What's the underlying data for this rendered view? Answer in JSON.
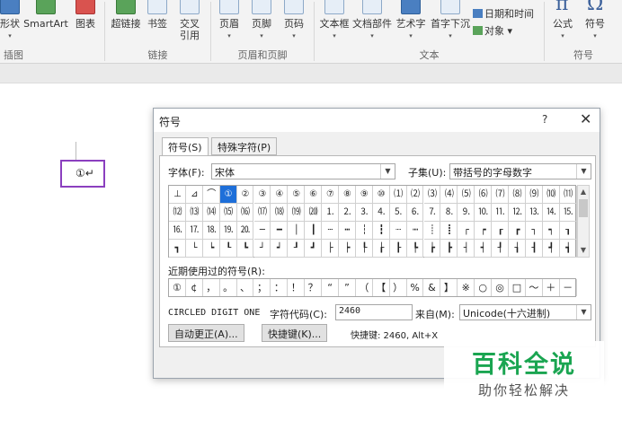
{
  "ribbon": {
    "buttons": [
      {
        "label": "形状",
        "caret": "▾"
      },
      {
        "label": "SmartArt",
        "caret": ""
      },
      {
        "label": "图表",
        "caret": ""
      },
      {
        "label": "超链接",
        "caret": ""
      },
      {
        "label": "书签",
        "caret": ""
      },
      {
        "label": "交叉\n引用",
        "caret": ""
      },
      {
        "label": "页眉",
        "caret": "▾"
      },
      {
        "label": "页脚",
        "caret": "▾"
      },
      {
        "label": "页码",
        "caret": "▾"
      },
      {
        "label": "文本框",
        "caret": "▾"
      },
      {
        "label": "文档部件",
        "caret": "▾"
      },
      {
        "label": "艺术字",
        "caret": "▾"
      },
      {
        "label": "首字下沉",
        "caret": "▾"
      },
      {
        "label": "公式",
        "caret": "▾"
      },
      {
        "label": "符号",
        "caret": "▾"
      }
    ],
    "small_items": [
      "日期和时间",
      "对象 ▾"
    ],
    "formula_glyph": "π",
    "symbol_glyph": "Ω",
    "groups": [
      "插图",
      "链接",
      "页眉和页脚",
      "文本",
      "符号"
    ]
  },
  "document": {
    "inserted_char": "①↵"
  },
  "dialog": {
    "title": "符号",
    "help": "?",
    "close": "✕",
    "tabs": [
      "符号(S)",
      "特殊字符(P)"
    ],
    "font_label": "字体(F):",
    "font_value": "宋体",
    "subset_label": "子集(U):",
    "subset_value": "带括号的字母数字",
    "grid_rows": [
      [
        "⊥",
        "⊿",
        "⌒",
        "①",
        "②",
        "③",
        "④",
        "⑤",
        "⑥",
        "⑦",
        "⑧",
        "⑨",
        "⑩",
        "⑴",
        "⑵",
        "⑶",
        "⑷",
        "⑸",
        "⑹",
        "⑺",
        "⑻",
        "⑼",
        "⑽",
        "⑾"
      ],
      [
        "⑿",
        "⒀",
        "⒁",
        "⒂",
        "⒃",
        "⒄",
        "⒅",
        "⒆",
        "⒇",
        "⒈",
        "⒉",
        "⒊",
        "⒋",
        "⒌",
        "⒍",
        "⒎",
        "⒏",
        "⒐",
        "⒑",
        "⒒",
        "⒓",
        "⒔",
        "⒕",
        "⒖"
      ],
      [
        "⒗",
        "⒘",
        "⒙",
        "⒚",
        "⒛",
        "─",
        "━",
        "│",
        "┃",
        "┄",
        "┅",
        "┆",
        "┇",
        "┈",
        "┉",
        "┊",
        "┋",
        "┌",
        "┍",
        "┎",
        "┏",
        "┐",
        "┑",
        "┒"
      ],
      [
        "┓",
        "└",
        "┕",
        "┖",
        "┗",
        "┘",
        "┙",
        "┚",
        "┛",
        "├",
        "┝",
        "┞",
        "┟",
        "┠",
        "┡",
        "┢",
        "┣",
        "┤",
        "┥",
        "┦",
        "┧",
        "┨",
        "┩",
        "┪"
      ]
    ],
    "selected_row": 0,
    "selected_col": 3,
    "recent_label": "近期使用过的符号(R):",
    "recent": [
      "①",
      "¢",
      "，",
      "。",
      "、",
      "；",
      "：",
      "！",
      "？",
      "“",
      "”",
      "（",
      "【",
      "）",
      "%",
      "&",
      "】",
      "※",
      "○",
      "◎",
      "□",
      "～",
      "＋",
      "－"
    ],
    "char_name": "CIRCLED DIGIT ONE",
    "code_label": "字符代码(C):",
    "code_value": "2460",
    "from_label": "来自(M):",
    "from_value": "Unicode(十六进制)",
    "autocorrect_button": "自动更正(A)...",
    "shortcut_button": "快捷键(K)...",
    "shortcut_info": "快捷键: 2460, Alt+X"
  },
  "watermark": {
    "title": "百科全说",
    "subtitle": "助你轻松解决"
  }
}
